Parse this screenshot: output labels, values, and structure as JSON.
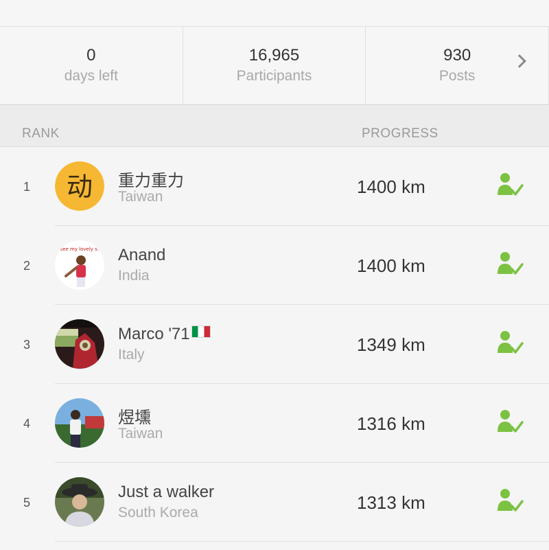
{
  "stats": [
    {
      "value": "0",
      "label": "days left"
    },
    {
      "value": "16,965",
      "label": "Participants"
    },
    {
      "value": "930",
      "label": "Posts"
    }
  ],
  "stats_next_icon": "chevron-right-icon",
  "table": {
    "rank_header": "RANK",
    "progress_header": "PROGRESS"
  },
  "rows": [
    {
      "rank": "1",
      "name": "重力重力",
      "country": "Taiwan",
      "progress": "1400 km",
      "avatar_glyph": "动"
    },
    {
      "rank": "2",
      "name": "Anand",
      "country": "India",
      "progress": "1400 km",
      "avatar_caption": "see my lovely s..."
    },
    {
      "rank": "3",
      "name": "Marco '71",
      "country": "Italy",
      "progress": "1349 km"
    },
    {
      "rank": "4",
      "name": "煜壎",
      "country": "Taiwan",
      "progress": "1316 km"
    },
    {
      "rank": "5",
      "name": "Just a walker",
      "country": "South Korea",
      "progress": "1313 km"
    }
  ],
  "colors": {
    "accent_green": "#7cc242",
    "avatar_yellow": "#f6b733"
  }
}
